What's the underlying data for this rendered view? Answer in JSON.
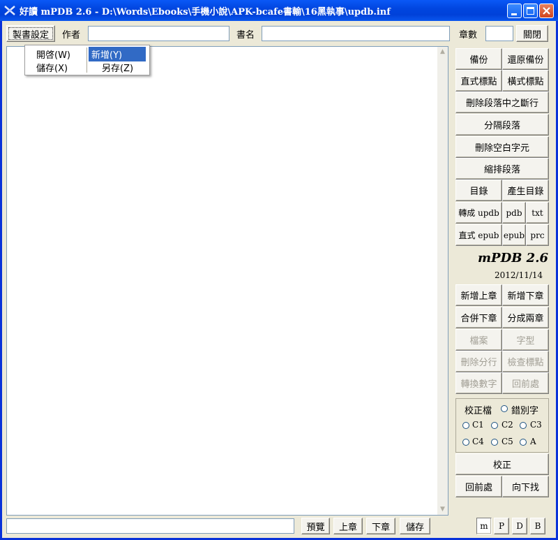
{
  "window": {
    "title": "好讀 mPDB 2.6 - D:\\Words\\Ebooks\\手機小說\\APK-bcafe書輸\\16黑執事\\updb.inf"
  },
  "toolbar": {
    "make_book_btn": "製書設定",
    "author_label": "作者",
    "author_value": "",
    "title_label": "書名",
    "title_value": "",
    "chapters_label": "章數",
    "chapters_value": "",
    "close_btn": "關閉"
  },
  "menu": {
    "open": "開啓(W)",
    "new": "新增(Y)",
    "save": "儲存(X)",
    "save_as": "另存(Z)"
  },
  "side": {
    "backup": "備份",
    "restore_backup": "還原備份",
    "vertical_punct": "直式標點",
    "horizontal_punct": "橫式標點",
    "remove_para_breaks": "刪除段落中之斷行",
    "split_para": "分隔段落",
    "remove_blank_chars": "刪除空白字元",
    "indent_para": "縮排段落",
    "toc": "目錄",
    "gen_toc": "產生目錄",
    "to_updb": "轉成 updb",
    "pdb": "pdb",
    "txt": "txt",
    "vertical_epub": "直式 epub",
    "epub": "epub",
    "prc": "prc",
    "app_name": "mPDB 2.6",
    "date": "2012/11/14",
    "add_prev_chapter": "新增上章",
    "add_next_chapter": "新增下章",
    "merge_next": "合併下章",
    "split_two": "分成兩章",
    "file": "檔案",
    "font": "字型",
    "remove_line_breaks": "刪除分行",
    "check_punct": "檢查標點",
    "convert_numbers": "轉換數字",
    "back_prev": "回前處",
    "proof_file": "校正檔",
    "typo": "錯別字",
    "c1": "C1",
    "c2": "C2",
    "c3": "C3",
    "c4": "C4",
    "c5": "C5",
    "a": "A",
    "proofread": "校正",
    "back": "回前處",
    "find_next": "向下找"
  },
  "bottom": {
    "input_value": "",
    "preview": "預覽",
    "prev_chapter": "上章",
    "next_chapter": "下章",
    "save": "儲存",
    "m": "m",
    "p": "P",
    "d": "D",
    "b": "B"
  }
}
